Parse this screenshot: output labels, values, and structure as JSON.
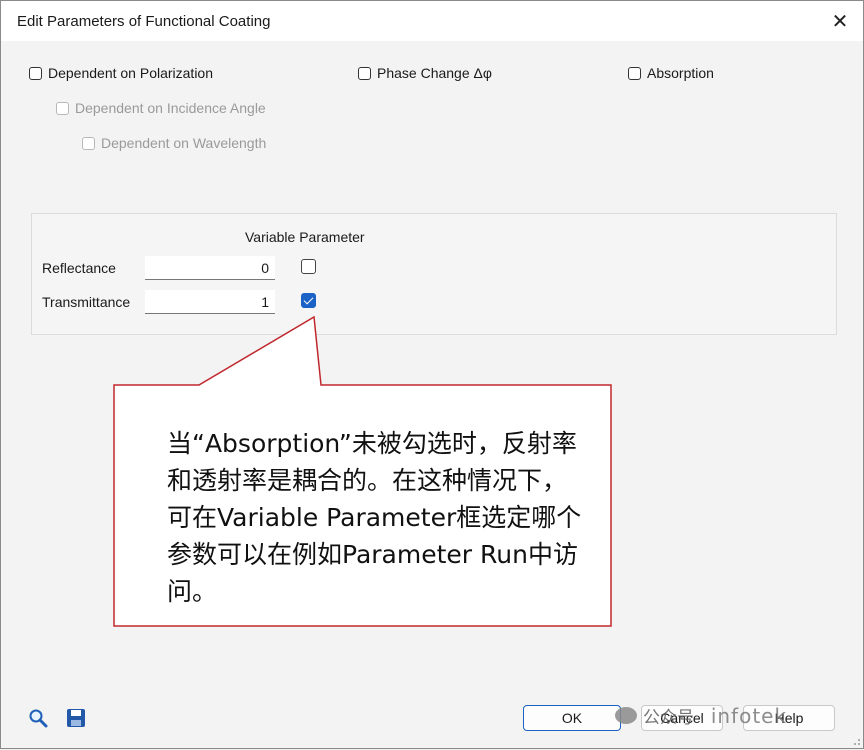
{
  "window": {
    "title": "Edit Parameters of Functional Coating",
    "close_glyph": "✕"
  },
  "options": {
    "dependent_polarization": {
      "label": "Dependent on Polarization",
      "checked": false
    },
    "phase_change": {
      "label": "Phase Change Δφ",
      "checked": false
    },
    "absorption": {
      "label": "Absorption",
      "checked": false
    },
    "dependent_incidence": {
      "label": "Dependent on Incidence Angle",
      "checked": false,
      "enabled": false
    },
    "dependent_wavelength": {
      "label": "Dependent on Wavelength",
      "checked": false,
      "enabled": false
    }
  },
  "params": {
    "header": "Variable Parameter",
    "rows": [
      {
        "label": "Reflectance",
        "value": "0",
        "variable": false
      },
      {
        "label": "Transmittance",
        "value": "1",
        "variable": true
      }
    ]
  },
  "callout": {
    "text": "当“Absorption”未被勾选时，反射率和透射率是耦合的。在这种情况下，可在Variable Parameter框选定哪个参数可以在例如Parameter Run中访问。",
    "border_color": "#c0282d"
  },
  "buttons": {
    "ok": "OK",
    "cancel": "Cancel",
    "help": "Help"
  },
  "icons": {
    "search": "search-icon",
    "save": "save-icon"
  },
  "watermark": {
    "text": "公众号 ·",
    "handle": "infotek"
  },
  "colors": {
    "accent": "#1a62c6"
  }
}
